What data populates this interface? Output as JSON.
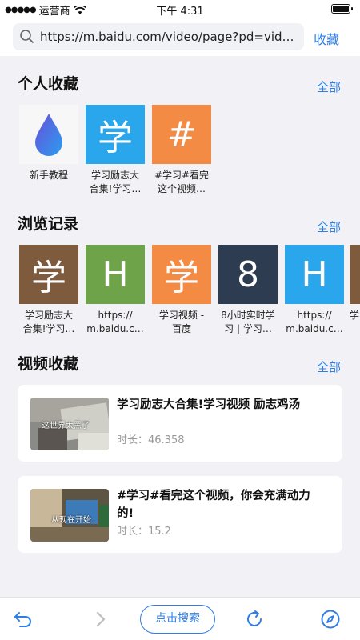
{
  "status": {
    "carrier": "运营商",
    "time": "下午 4:31"
  },
  "urlbar": {
    "url": "https://m.baidu.com/video/page?pd=video_...",
    "fav_label": "收藏"
  },
  "sections": {
    "personal": {
      "title": "个人收藏",
      "all": "全部"
    },
    "history": {
      "title": "浏览记录",
      "all": "全部"
    },
    "videos": {
      "title": "视频收藏",
      "all": "全部"
    }
  },
  "personal_items": [
    {
      "glyph": "",
      "caption": "新手教程",
      "color": "#f7f7f7"
    },
    {
      "glyph": "学",
      "caption": "学习励志大\n合集!学习…",
      "color": "#2aa6ec"
    },
    {
      "glyph": "#",
      "caption": "#学习#看完\n这个视频…",
      "color": "#f38b45"
    }
  ],
  "history_items": [
    {
      "glyph": "学",
      "caption": "学习励志大\n合集!学习…",
      "color": "#7d5b3c"
    },
    {
      "glyph": "H",
      "caption": "https://\nm.baidu.c…",
      "color": "#6fa34a"
    },
    {
      "glyph": "学",
      "caption": "学习视频 -\n百度",
      "color": "#f38b45"
    },
    {
      "glyph": "8",
      "caption": "8小时实时学\n习 | 学习…",
      "color": "#2d3c50"
    },
    {
      "glyph": "H",
      "caption": "https://\nm.baidu.c…",
      "color": "#2aa6ec"
    },
    {
      "glyph": "学",
      "caption": "学",
      "color": "#7d5b3c"
    }
  ],
  "videos": [
    {
      "title": "学习励志大合集!学习视频 励志鸡汤",
      "duration": "时长：46.358",
      "thumb_text": "这世界太黑了"
    },
    {
      "title": "#学习#看完这个视频，你会充满动力的!",
      "duration": "时长：15.2",
      "thumb_text": "从现在开始"
    }
  ],
  "toolbar": {
    "search_label": "点击搜索"
  },
  "colors": {
    "accent": "#2d7ee5"
  }
}
